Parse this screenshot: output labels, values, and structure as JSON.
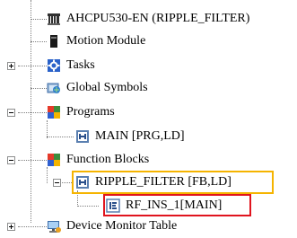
{
  "tree": {
    "items": [
      {
        "label": "AHCPU530-EN  (RIPPLE_FILTER)",
        "icon": "cpu-icon"
      },
      {
        "label": "Motion Module",
        "icon": "motion-module-icon"
      },
      {
        "label": "Tasks",
        "icon": "tasks-icon"
      },
      {
        "label": "Global Symbols",
        "icon": "global-symbols-icon"
      },
      {
        "label": "Programs",
        "icon": "programs-icon"
      },
      {
        "label": "MAIN [PRG,LD]",
        "icon": "program-block-icon"
      },
      {
        "label": "Function Blocks",
        "icon": "function-blocks-icon"
      },
      {
        "label": "RIPPLE_FILTER [FB,LD]",
        "icon": "function-block-icon"
      },
      {
        "label": "RF_INS_1[MAIN]",
        "icon": "instance-icon"
      },
      {
        "label": "Device Monitor Table",
        "icon": "device-monitor-icon"
      }
    ]
  },
  "colors": {
    "highlight_yellow": "#f5b400",
    "highlight_red": "#e0141e"
  }
}
